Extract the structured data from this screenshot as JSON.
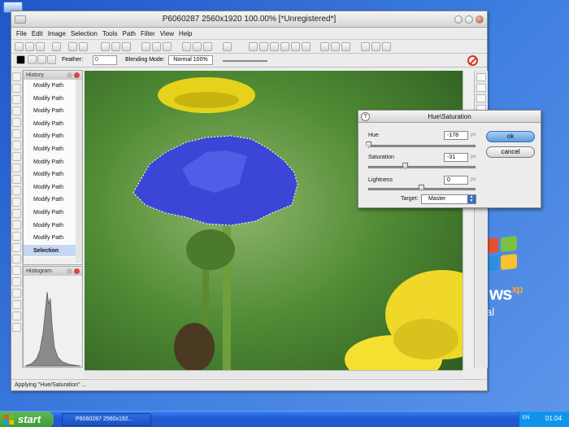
{
  "window": {
    "title": "P6060287 2560x1920 100.00% [*Unregistered*]"
  },
  "menu": [
    "File",
    "Edit",
    "Image",
    "Selection",
    "Tools",
    "Path",
    "Filter",
    "View",
    "Help"
  ],
  "options_bar": {
    "feather_label": "Feather:",
    "feather_value": "0",
    "blending_label": "Blending Mode:",
    "blending_value": "Normal 100%"
  },
  "history": {
    "title": "History",
    "items": [
      "Modify Path",
      "Modify Path",
      "Modify Path",
      "Modify Path",
      "Modify Path",
      "Modify Path",
      "Modify Path",
      "Modify Path",
      "Modify Path",
      "Modify Path",
      "Modify Path",
      "Modify Path",
      "Modify Path",
      "Selection"
    ],
    "selected": "Selection"
  },
  "histogram": {
    "title": "Histogram"
  },
  "hue_saturation": {
    "title": "Hue\\Saturation",
    "help": "?",
    "hue_label": "Hue",
    "hue_value": "-178",
    "hue_level": 0.01,
    "sat_label": "Saturation",
    "sat_value": "-31",
    "sat_level": 0.35,
    "light_label": "Lightness",
    "light_value": "0",
    "light_level": 0.5,
    "unit": "px",
    "target_label": "Target:",
    "target_value": "Master",
    "ok_label": "ok",
    "cancel_label": "cancel"
  },
  "status": {
    "text": "Applying \"Hue/Saturation\" ..."
  },
  "taskbar": {
    "start_label": "start",
    "task_label": "P6060287 2560x192...",
    "lang": "EN",
    "clock": "01:04"
  },
  "desktop": {
    "xp_text": "ws",
    "xp_super": "xp",
    "xp_tail": "al"
  }
}
